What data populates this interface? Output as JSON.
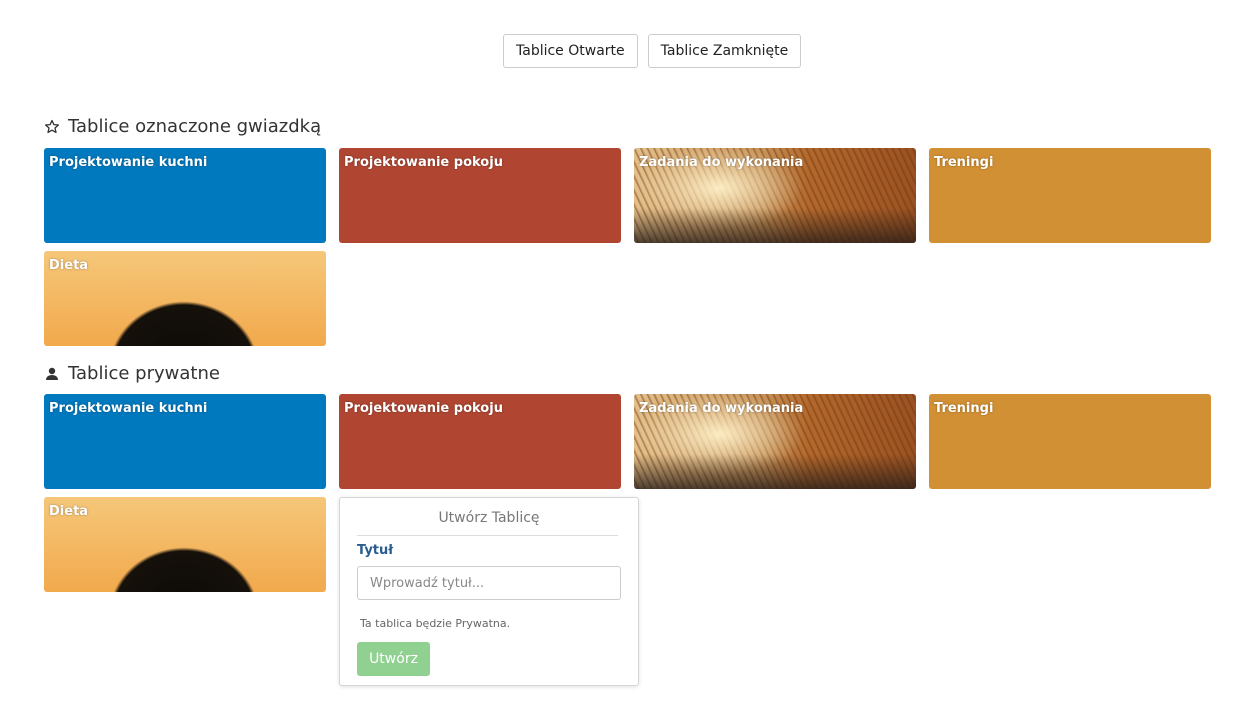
{
  "top_buttons": {
    "open_label": "Tablice Otwarte",
    "closed_label": "Tablice Zamknięte"
  },
  "sections": [
    {
      "title": "Tablice oznaczone gwiazdką",
      "icon": "star-icon",
      "boards": [
        {
          "title": "Projektowanie kuchni",
          "bg": "blue"
        },
        {
          "title": "Projektowanie pokoju",
          "bg": "red"
        },
        {
          "title": "Zadania do wykonania",
          "bg": "image-field"
        },
        {
          "title": "Treningi",
          "bg": "orange"
        },
        {
          "title": "Dieta",
          "bg": "image-jacket"
        }
      ]
    },
    {
      "title": "Tablice prywatne",
      "icon": "user-icon",
      "boards": [
        {
          "title": "Projektowanie kuchni",
          "bg": "blue"
        },
        {
          "title": "Projektowanie pokoju",
          "bg": "red"
        },
        {
          "title": "Zadania do wykonania",
          "bg": "image-field"
        },
        {
          "title": "Treningi",
          "bg": "orange"
        },
        {
          "title": "Dieta",
          "bg": "image-jacket"
        }
      ]
    }
  ],
  "create_popover": {
    "title": "Utwórz Tablicę",
    "field_label": "Tytuł",
    "input_placeholder": "Wprowadź tytuł...",
    "input_value": "",
    "note": "Ta tablica będzie Prywatna.",
    "submit_label": "Utwórz"
  },
  "colors": {
    "blue": "#0079bf",
    "red": "#b04632",
    "orange": "#d29034",
    "submit_green": "#90d192",
    "label_blue": "#2a5d8f"
  }
}
